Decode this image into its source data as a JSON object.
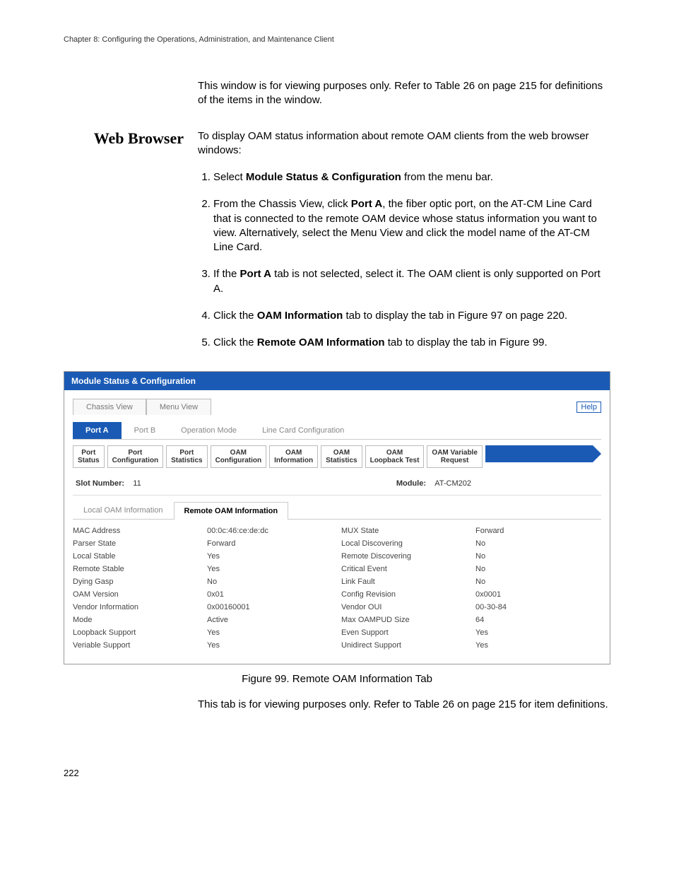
{
  "chapter_header": "Chapter 8: Configuring the Operations, Administration, and Maintenance Client",
  "intro_para": "This window is for viewing purposes only. Refer to Table 26 on page 215 for definitions of the items in the window.",
  "side_heading": "Web Browser",
  "lead_para": "To display OAM status information about remote OAM clients from the web browser windows:",
  "steps": {
    "s1_a": "Select ",
    "s1_b": "Module Status & Configuration",
    "s1_c": " from the menu bar.",
    "s2_a": "From the Chassis View, click ",
    "s2_b": "Port A",
    "s2_c": ", the fiber optic port, on the AT-CM Line Card that is connected to the remote OAM device whose status information you want to view. Alternatively, select the Menu View and click the model name of the AT-CM Line Card.",
    "s3_a": "If the ",
    "s3_b": "Port A",
    "s3_c": " tab is not selected, select it. The OAM client is only supported on Port A.",
    "s4_a": "Click the ",
    "s4_b": "OAM Information",
    "s4_c": " tab to display the tab in Figure 97 on page 220.",
    "s5_a": "Click the ",
    "s5_b": "Remote OAM Information",
    "s5_c": " tab to display the tab in Figure 99."
  },
  "figure": {
    "title_bar": "Module Status & Configuration",
    "view_tabs": [
      "Chassis View",
      "Menu View"
    ],
    "help_label": "Help",
    "port_tabs": [
      "Port A",
      "Port B",
      "Operation Mode",
      "Line Card Configuration"
    ],
    "sub_tabs": [
      "Port\nStatus",
      "Port\nConfiguration",
      "Port\nStatistics",
      "OAM\nConfiguration",
      "OAM\nInformation",
      "OAM\nStatistics",
      "OAM\nLoopback Test",
      "OAM Variable\nRequest"
    ],
    "slot_label": "Slot Number:",
    "slot_value": "11",
    "module_label": "Module:",
    "module_value": "AT-CM202",
    "inner_tabs": [
      "Local OAM Information",
      "Remote OAM Information"
    ],
    "rows": [
      {
        "l1": "MAC Address",
        "v1": "00:0c:46:ce:de:dc",
        "l2": "MUX State",
        "v2": "Forward"
      },
      {
        "l1": "Parser State",
        "v1": "Forward",
        "l2": "Local Discovering",
        "v2": "No"
      },
      {
        "l1": "Local Stable",
        "v1": "Yes",
        "l2": "Remote Discovering",
        "v2": "No"
      },
      {
        "l1": "Remote Stable",
        "v1": "Yes",
        "l2": "Critical Event",
        "v2": "No"
      },
      {
        "l1": "Dying Gasp",
        "v1": "No",
        "l2": "Link Fault",
        "v2": "No"
      },
      {
        "l1": "OAM Version",
        "v1": "0x01",
        "l2": "Config Revision",
        "v2": "0x0001"
      },
      {
        "l1": "Vendor Information",
        "v1": "0x00160001",
        "l2": "Vendor OUI",
        "v2": "00-30-84"
      },
      {
        "l1": "Mode",
        "v1": "Active",
        "l2": "Max OAMPUD Size",
        "v2": "64"
      },
      {
        "l1": "Loopback Support",
        "v1": "Yes",
        "l2": "Even Support",
        "v2": "Yes"
      },
      {
        "l1": "Veriable Support",
        "v1": "Yes",
        "l2": "Unidirect Support",
        "v2": "Yes"
      }
    ]
  },
  "figure_caption": "Figure 99. Remote OAM Information Tab",
  "closing_para": "This tab is for viewing purposes only. Refer to Table 26 on page 215 for item definitions.",
  "page_number": "222"
}
